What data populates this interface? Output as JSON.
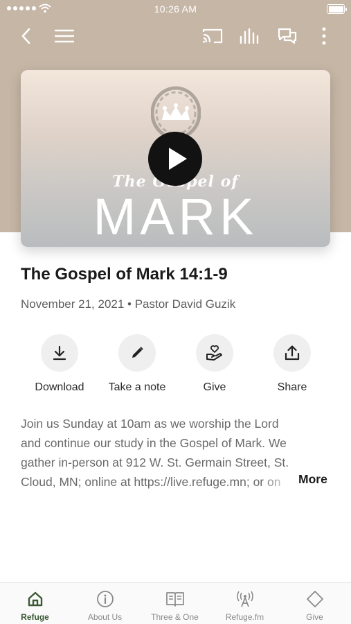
{
  "status_bar": {
    "time": "10:26 AM"
  },
  "top_bar": {
    "icons": [
      "back-icon",
      "menu-icon",
      "cast-icon",
      "audio-bars-icon",
      "chat-icon",
      "more-vertical-icon"
    ]
  },
  "artwork": {
    "subtitle_text": "The Gospel of",
    "main_text": "MARK",
    "play_icon": "play-icon"
  },
  "episode": {
    "title": "The Gospel of Mark 14:1-9",
    "meta": "November 21, 2021 • Pastor David Guzik"
  },
  "actions": [
    {
      "label": "Download",
      "icon": "download-icon"
    },
    {
      "label": "Take a note",
      "icon": "pencil-icon"
    },
    {
      "label": "Give",
      "icon": "give-heart-hand-icon"
    },
    {
      "label": "Share",
      "icon": "share-icon"
    }
  ],
  "description": {
    "lines": [
      "Join us Sunday at 10am as we worship the Lord",
      "and continue our study in the Gospel of Mark. We",
      "gather in-person at 912 W. St. Germain Street, St.",
      "Cloud, MN; online at https://live.refuge.mn; or on"
    ],
    "more_label": "More"
  },
  "tabbar": {
    "active": "Refuge",
    "active_color": "#3b5a34",
    "items": [
      {
        "label": "Refuge",
        "icon": "home-icon"
      },
      {
        "label": "About Us",
        "icon": "info-icon"
      },
      {
        "label": "Three & One",
        "icon": "book-icon"
      },
      {
        "label": "Refuge.fm",
        "icon": "radio-tower-icon"
      },
      {
        "label": "Give",
        "icon": "diamond-icon"
      }
    ]
  },
  "colors": {
    "hero_background": "#c6b6a6",
    "play_button": "#121212"
  }
}
